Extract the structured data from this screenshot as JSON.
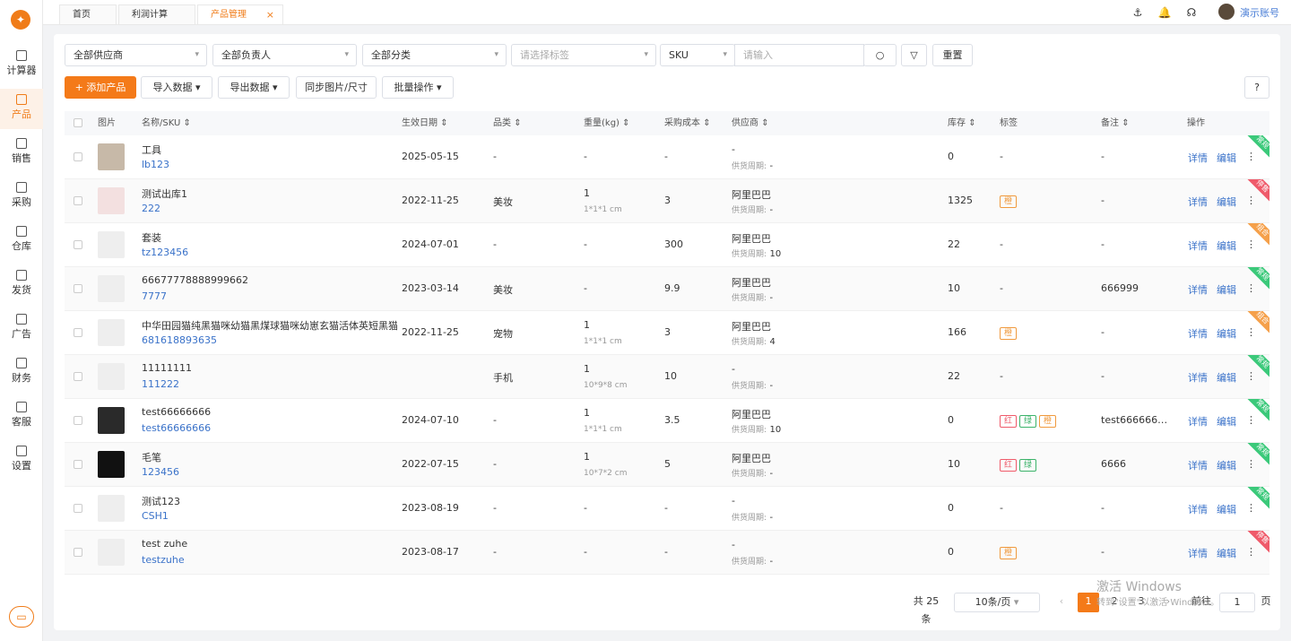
{
  "sidebar": {
    "logo": "✦",
    "items": [
      {
        "label": "计算器",
        "icon": "calculator-icon"
      },
      {
        "label": "产品",
        "icon": "product-icon",
        "active": true
      },
      {
        "label": "销售",
        "icon": "sales-icon"
      },
      {
        "label": "采购",
        "icon": "purchase-icon"
      },
      {
        "label": "仓库",
        "icon": "warehouse-icon"
      },
      {
        "label": "发货",
        "icon": "shipping-icon"
      },
      {
        "label": "广告",
        "icon": "ad-icon"
      },
      {
        "label": "财务",
        "icon": "finance-icon"
      },
      {
        "label": "客服",
        "icon": "service-icon"
      },
      {
        "label": "设置",
        "icon": "settings-icon"
      }
    ],
    "bottom_icon": "▭"
  },
  "tabs": [
    {
      "label": "首页"
    },
    {
      "label": "利润计算"
    },
    {
      "label": "产品管理",
      "close": "×"
    }
  ],
  "header": {
    "icons": {
      "anchor": "⚓",
      "bell": "🔔",
      "headset": "☊"
    },
    "user": "演示账号"
  },
  "filters": {
    "supplier": "全部供应商",
    "owner": "全部负责人",
    "category": "全部分类",
    "tags_placeholder": "请选择标签",
    "sku_field": "SKU",
    "search_placeholder": "请输入",
    "reset": "重置"
  },
  "toolbar": {
    "add": "+ 添加产品",
    "import": "导入数据",
    "export": "导出数据",
    "sync": "同步图片/尺寸",
    "batch": "批量操作",
    "help": "?"
  },
  "columns": [
    "图片",
    "名称/SKU",
    "生效日期",
    "品类",
    "重量(kg)",
    "采购成本",
    "供应商",
    "库存",
    "标签",
    "备注",
    "操作"
  ],
  "sort_glyph": "⇕",
  "supply_label": "供货周期:",
  "actions": {
    "detail": "详情",
    "edit": "编辑",
    "more": "⋮"
  },
  "rows": [
    {
      "name": "工具",
      "sku": "lb123",
      "date": "2025-05-15",
      "category": "-",
      "weight": "-",
      "dims": "",
      "cost": "-",
      "supplier": "-",
      "cycle": "-",
      "stock": "0",
      "tags": [],
      "note": "-",
      "status": "常规",
      "status_color": "#3bc97a",
      "thumb": "#c7b9a8"
    },
    {
      "name": "测试出库1",
      "sku": "222",
      "date": "2022-11-25",
      "category": "美妆",
      "weight": "1",
      "dims": "1*1*1 cm",
      "cost": "3",
      "supplier": "阿里巴巴",
      "cycle": "-",
      "stock": "1325",
      "tags": [
        {
          "text": "橙",
          "color": "#f09a3e"
        }
      ],
      "note": "-",
      "status": "停售",
      "status_color": "#ef5a6a",
      "thumb": "#f3e0e0"
    },
    {
      "name": "套装",
      "sku": "tz123456",
      "date": "2024-07-01",
      "category": "-",
      "weight": "-",
      "dims": "",
      "cost": "300",
      "supplier": "阿里巴巴",
      "cycle": "10",
      "stock": "22",
      "tags": [],
      "note": "-",
      "status": "组合",
      "status_color": "#f5a04a",
      "thumb": "#eeeeee"
    },
    {
      "name": "66677778888999662",
      "sku": "7777",
      "date": "2023-03-14",
      "category": "美妆",
      "weight": "-",
      "dims": "",
      "cost": "9.9",
      "supplier": "阿里巴巴",
      "cycle": "-",
      "stock": "10",
      "tags": [],
      "note": "666999",
      "status": "常规",
      "status_color": "#3bc97a",
      "thumb": "#eeeeee"
    },
    {
      "name": "中华田园猫纯黑猫咪幼猫黑煤球猫咪幼崽玄猫活体英短黑猫猫",
      "sku": "681618893635",
      "date": "2022-11-25",
      "category": "宠物",
      "weight": "1",
      "dims": "1*1*1 cm",
      "cost": "3",
      "supplier": "阿里巴巴",
      "cycle": "4",
      "stock": "166",
      "tags": [
        {
          "text": "橙",
          "color": "#f09a3e"
        }
      ],
      "note": "-",
      "status": "组合",
      "status_color": "#f5a04a",
      "thumb": "#eeeeee"
    },
    {
      "name": "11111111",
      "sku": "111222",
      "date": "",
      "category": "手机",
      "weight": "1",
      "dims": "10*9*8 cm",
      "cost": "10",
      "supplier": "-",
      "cycle": "-",
      "stock": "22",
      "tags": [],
      "note": "-",
      "status": "常规",
      "status_color": "#3bc97a",
      "thumb": "#eeeeee"
    },
    {
      "name": "test66666666",
      "sku": "test66666666",
      "date": "2024-07-10",
      "category": "-",
      "weight": "1",
      "dims": "1*1*1 cm",
      "cost": "3.5",
      "supplier": "阿里巴巴",
      "cycle": "10",
      "stock": "0",
      "tags": [
        {
          "text": "红",
          "color": "#ef5a6a"
        },
        {
          "text": "绿",
          "color": "#3bb36a"
        },
        {
          "text": "橙",
          "color": "#f09a3e"
        }
      ],
      "note": "test6666666...",
      "status": "常规",
      "status_color": "#3bc97a",
      "thumb": "#2a2a2a"
    },
    {
      "name": "毛笔",
      "sku": "123456",
      "date": "2022-07-15",
      "category": "-",
      "weight": "1",
      "dims": "10*7*2 cm",
      "cost": "5",
      "supplier": "阿里巴巴",
      "cycle": "-",
      "stock": "10",
      "tags": [
        {
          "text": "红",
          "color": "#ef5a6a"
        },
        {
          "text": "绿",
          "color": "#3bb36a"
        }
      ],
      "note": "6666",
      "status": "常规",
      "status_color": "#3bc97a",
      "thumb": "#111111"
    },
    {
      "name": "测试123",
      "sku": "CSH1",
      "date": "2023-08-19",
      "category": "-",
      "weight": "-",
      "dims": "",
      "cost": "-",
      "supplier": "-",
      "cycle": "-",
      "stock": "0",
      "tags": [],
      "note": "-",
      "status": "常规",
      "status_color": "#3bc97a",
      "thumb": "#eeeeee"
    },
    {
      "name": "test zuhe",
      "sku": "testzuhe",
      "date": "2023-08-17",
      "category": "-",
      "weight": "-",
      "dims": "",
      "cost": "-",
      "supplier": "-",
      "cycle": "-",
      "stock": "0",
      "tags": [
        {
          "text": "橙",
          "color": "#f09a3e"
        }
      ],
      "note": "-",
      "status": "停售",
      "status_color": "#ef5a6a",
      "thumb": "#eeeeee"
    }
  ],
  "pagination": {
    "total": "共 25 条",
    "page_size": "10条/页",
    "prev": "‹",
    "pages": [
      "1",
      "2",
      "3"
    ],
    "next": "›",
    "current": "1",
    "goto_label": "前往",
    "goto_value": "1",
    "page_suffix": "页"
  },
  "watermark": {
    "line1": "激活 Windows",
    "line2": "转到\"设置\"以激活 Windows。"
  }
}
